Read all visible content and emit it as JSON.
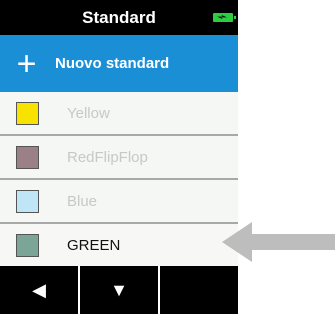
{
  "titlebar": {
    "title": "Standard",
    "icon": "battery-charging-icon"
  },
  "new_standard": {
    "icon": "plus-icon",
    "label": "Nuovo standard"
  },
  "standards": [
    {
      "label": "Yellow",
      "color": "#f7e200",
      "active": false
    },
    {
      "label": "RedFlipFlop",
      "color": "#9b8088",
      "active": false
    },
    {
      "label": "Blue",
      "color": "#bfe6f7",
      "active": false
    },
    {
      "label": "GREEN",
      "color": "#7aa597",
      "active": true
    }
  ],
  "softkeys": [
    {
      "icon": "triangle-left-icon",
      "glyph": "◀"
    },
    {
      "icon": "triangle-down-icon",
      "glyph": "▼"
    },
    {
      "icon": "",
      "glyph": ""
    }
  ],
  "colors": {
    "accent": "#1b8fd6",
    "titlebar": "#000000",
    "battery": "#2ecc40",
    "callout_arrow": "#bdbdbd"
  }
}
